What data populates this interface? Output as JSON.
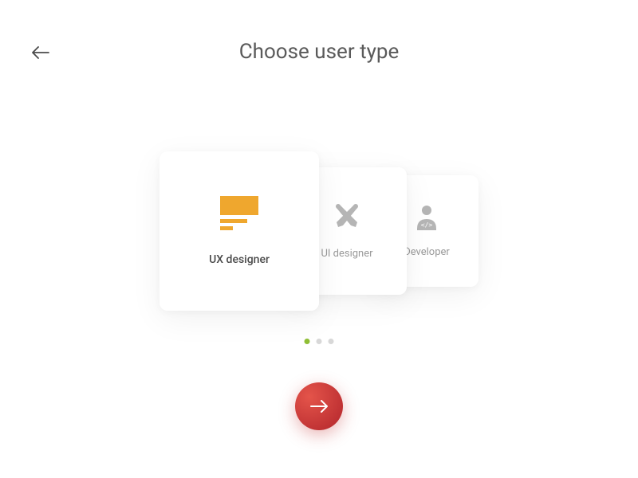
{
  "header": {
    "title": "Choose user type"
  },
  "cards": [
    {
      "label": "UX designer",
      "icon": "layout-icon"
    },
    {
      "label": "UI designer",
      "icon": "pencil-brush-icon"
    },
    {
      "label": "Developer",
      "icon": "dev-person-icon"
    }
  ],
  "pagination": {
    "total": 3,
    "active": 0
  },
  "colors": {
    "accent": "#efa72e",
    "dot_active": "#8fbe35",
    "cta": "#c0322e"
  }
}
